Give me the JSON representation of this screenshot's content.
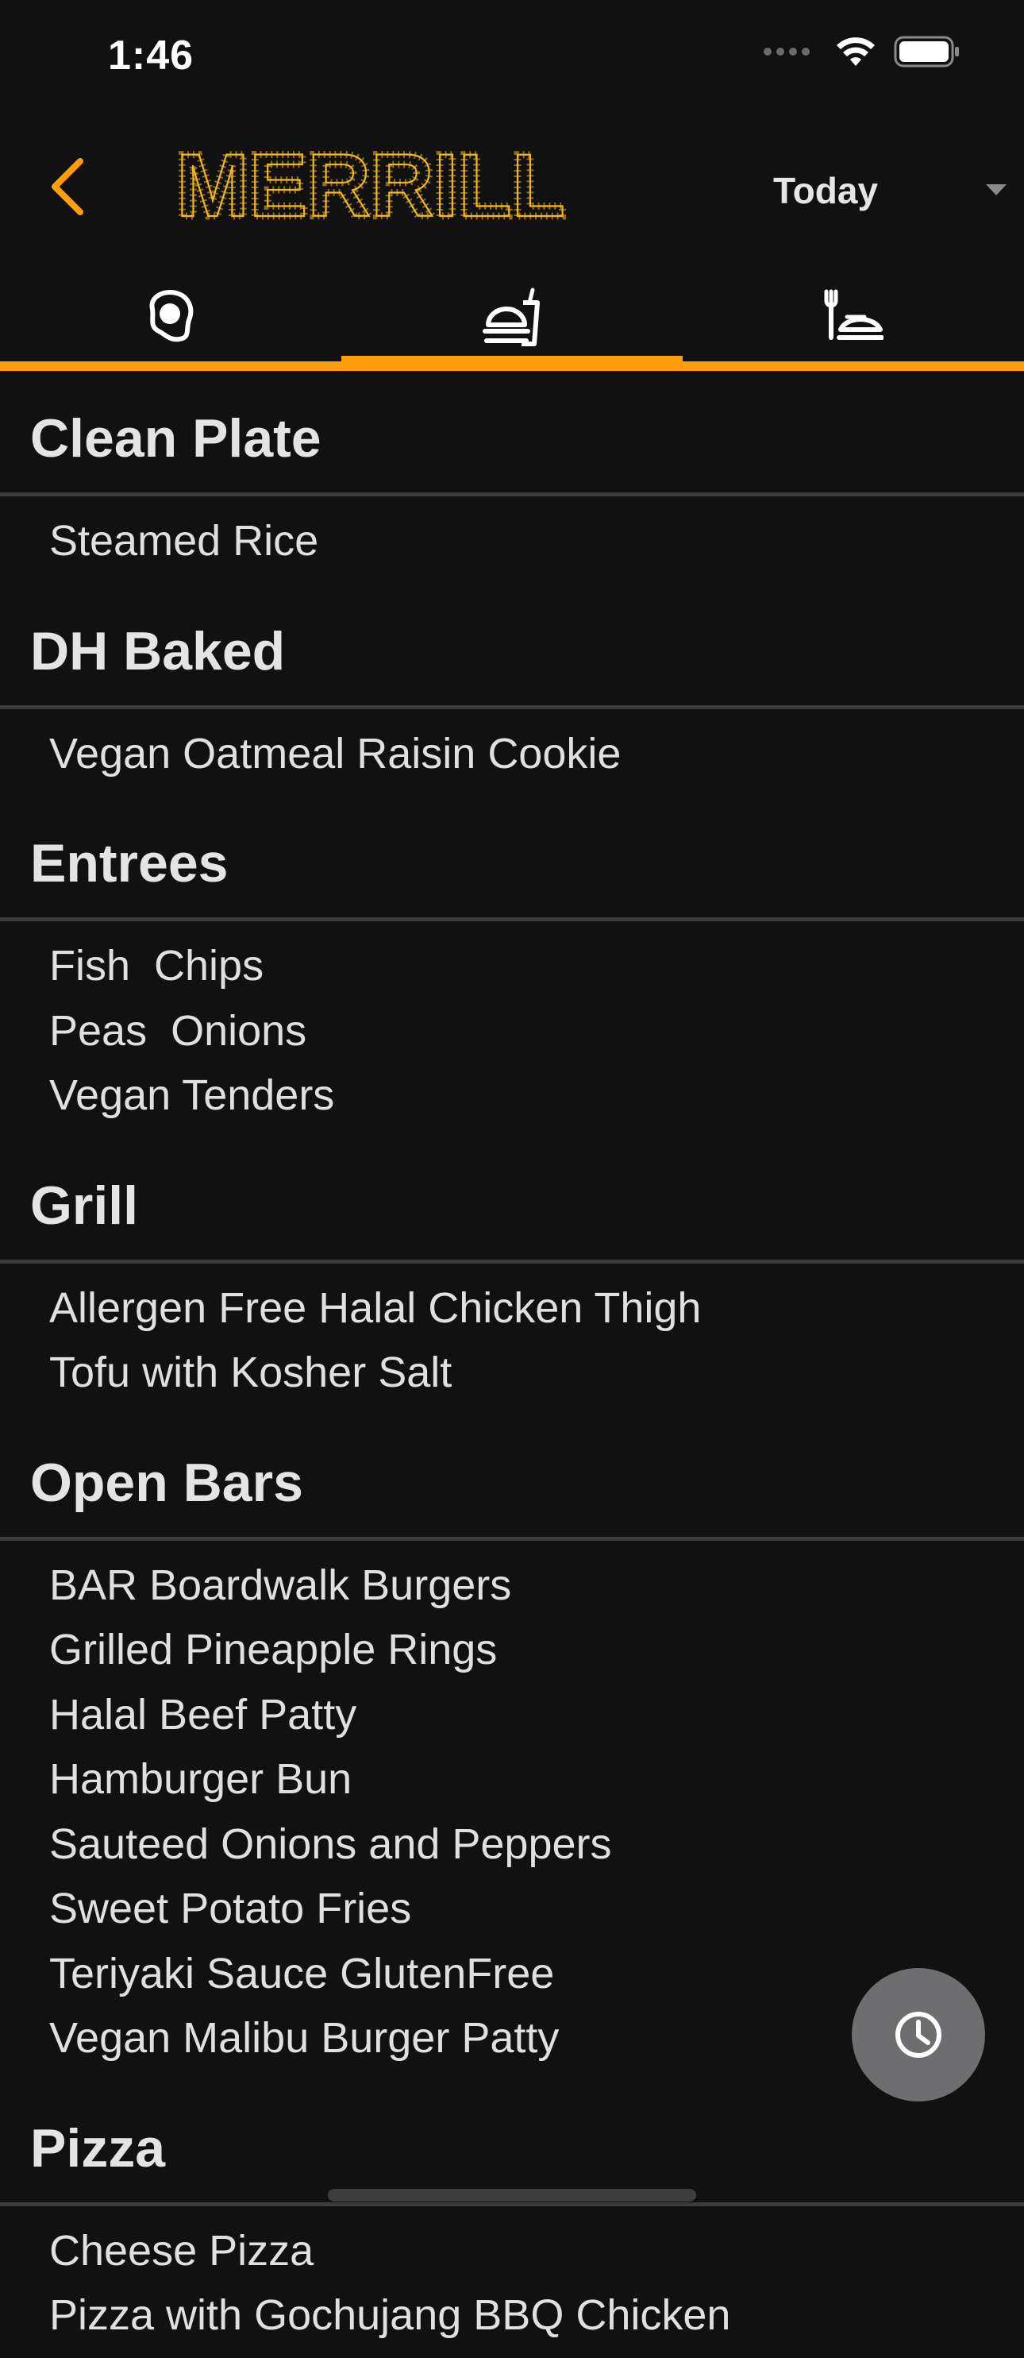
{
  "status_bar": {
    "time": "1:46"
  },
  "header": {
    "logo_text": "MERRILL",
    "date_selected": "Today"
  },
  "colors": {
    "accent": "#ff9d0a",
    "background": "#111112",
    "divider": "#3c3c3e",
    "fab": "#6e6e70"
  },
  "tabs": [
    {
      "icon": "breakfast-egg-icon",
      "selected": false
    },
    {
      "icon": "lunch-tray-icon",
      "selected": true
    },
    {
      "icon": "dinner-plate-icon",
      "selected": false
    }
  ],
  "menu": {
    "sections": [
      {
        "title": "Clean Plate",
        "items": [
          "Steamed Rice"
        ]
      },
      {
        "title": "DH Baked",
        "items": [
          "Vegan Oatmeal Raisin Cookie"
        ]
      },
      {
        "title": "Entrees",
        "items": [
          "Fish  Chips",
          "Peas  Onions",
          "Vegan Tenders"
        ]
      },
      {
        "title": "Grill",
        "items": [
          "Allergen Free Halal Chicken Thigh",
          "Tofu with Kosher Salt"
        ]
      },
      {
        "title": "Open Bars",
        "items": [
          "BAR Boardwalk Burgers",
          "Grilled Pineapple Rings",
          "Halal Beef Patty",
          "Hamburger Bun",
          "Sauteed Onions and Peppers",
          "Sweet Potato Fries",
          "Teriyaki Sauce GlutenFree",
          "Vegan Malibu Burger Patty"
        ]
      },
      {
        "title": "Pizza",
        "items": [
          "Cheese Pizza",
          "Pizza with Gochujang BBQ Chicken"
        ]
      }
    ]
  },
  "fab": {
    "icon": "clock-icon"
  }
}
